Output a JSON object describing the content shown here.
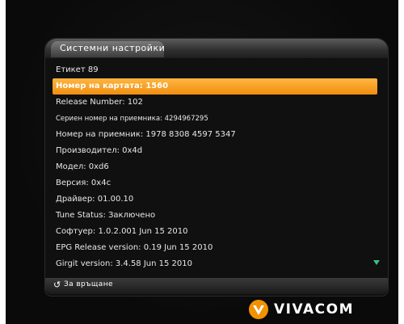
{
  "panel": {
    "title": "Системни настройки"
  },
  "info_rows": [
    {
      "text": "Етикет 89",
      "selected": false,
      "small": false
    },
    {
      "text": "Номер на картата: 1560",
      "selected": true,
      "small": false
    },
    {
      "text": "Release Number: 102",
      "selected": false,
      "small": false
    },
    {
      "text": "Сериен номер на приемника: 4294967295",
      "selected": false,
      "small": true
    },
    {
      "text": "Номер на приемник: 1978 8308 4597 5347",
      "selected": false,
      "small": false
    },
    {
      "text": "Производител: 0x4d",
      "selected": false,
      "small": false
    },
    {
      "text": "Модел: 0xd6",
      "selected": false,
      "small": false
    },
    {
      "text": "Версия: 0x4c",
      "selected": false,
      "small": false
    },
    {
      "text": "Драйвер: 01.00.10",
      "selected": false,
      "small": false
    },
    {
      "text": "Tune Status: Заключено",
      "selected": false,
      "small": false
    },
    {
      "text": "Софтуер: 1.0.2.001 Jun 15  2010",
      "selected": false,
      "small": false
    },
    {
      "text": "EPG Release version: 0.19  Jun 15  2010",
      "selected": false,
      "small": false
    },
    {
      "text": "Girgit version: 3.4.58  Jun 15  2010",
      "selected": false,
      "small": false
    }
  ],
  "footer": {
    "back_icon": "back-arrow-icon",
    "back_label": "За връщане"
  },
  "brand": {
    "logo_text": "VIVACOM",
    "logo_icon": "vivacom-v-logo",
    "color": "#f39200"
  },
  "colors": {
    "selection": "#f39200",
    "scroll_indicator": "#3fbf7f"
  }
}
